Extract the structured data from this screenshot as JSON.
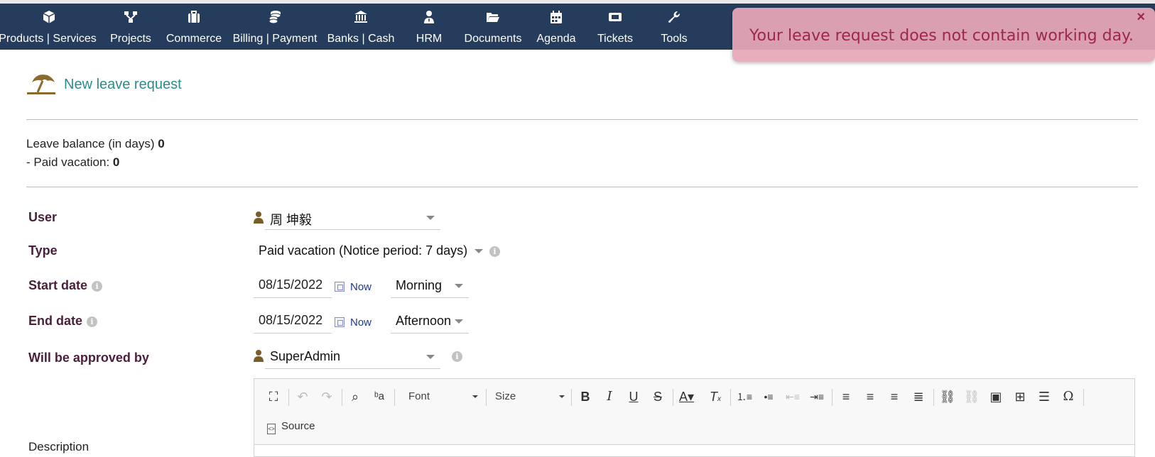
{
  "nav": {
    "items": [
      {
        "label": "Products | Services",
        "icon": "cube-icon"
      },
      {
        "label": "Projects",
        "icon": "project-tree-icon"
      },
      {
        "label": "Commerce",
        "icon": "briefcase-icon"
      },
      {
        "label": "Billing | Payment",
        "icon": "coins-icon"
      },
      {
        "label": "Banks | Cash",
        "icon": "bank-icon"
      },
      {
        "label": "HRM",
        "icon": "user-tie-icon"
      },
      {
        "label": "Documents",
        "icon": "folder-open-icon"
      },
      {
        "label": "Agenda",
        "icon": "calendar-icon"
      },
      {
        "label": "Tickets",
        "icon": "ticket-icon"
      },
      {
        "label": "Tools",
        "icon": "wrench-icon"
      }
    ]
  },
  "toast": {
    "message": "Your leave request does not contain working day.",
    "close": "×"
  },
  "page": {
    "title": "New leave request",
    "balance_label": "Leave balance (in days)",
    "balance_value": "0",
    "paid_label": "- Paid vacation:",
    "paid_value": "0"
  },
  "form": {
    "user_label": "User",
    "user_value": "周 坤毅",
    "type_label": "Type",
    "type_value": "Paid vacation (Notice period: 7 days)",
    "start_label": "Start date",
    "start_value": "08/15/2022",
    "start_now": "Now",
    "start_half": "Morning",
    "end_label": "End date",
    "end_value": "08/15/2022",
    "end_now": "Now",
    "end_half": "Afternoon",
    "approver_label": "Will be approved by",
    "approver_value": "SuperAdmin",
    "description_label": "Description"
  },
  "editor": {
    "font_label": "Font",
    "size_label": "Size",
    "source_label": "Source"
  },
  "colors": {
    "nav_bg": "#263c5c",
    "toast_bg": "#e8a8b8",
    "toast_text": "#a8264c",
    "label_color": "#4a1f3c",
    "title_color": "#2e8b8b"
  }
}
